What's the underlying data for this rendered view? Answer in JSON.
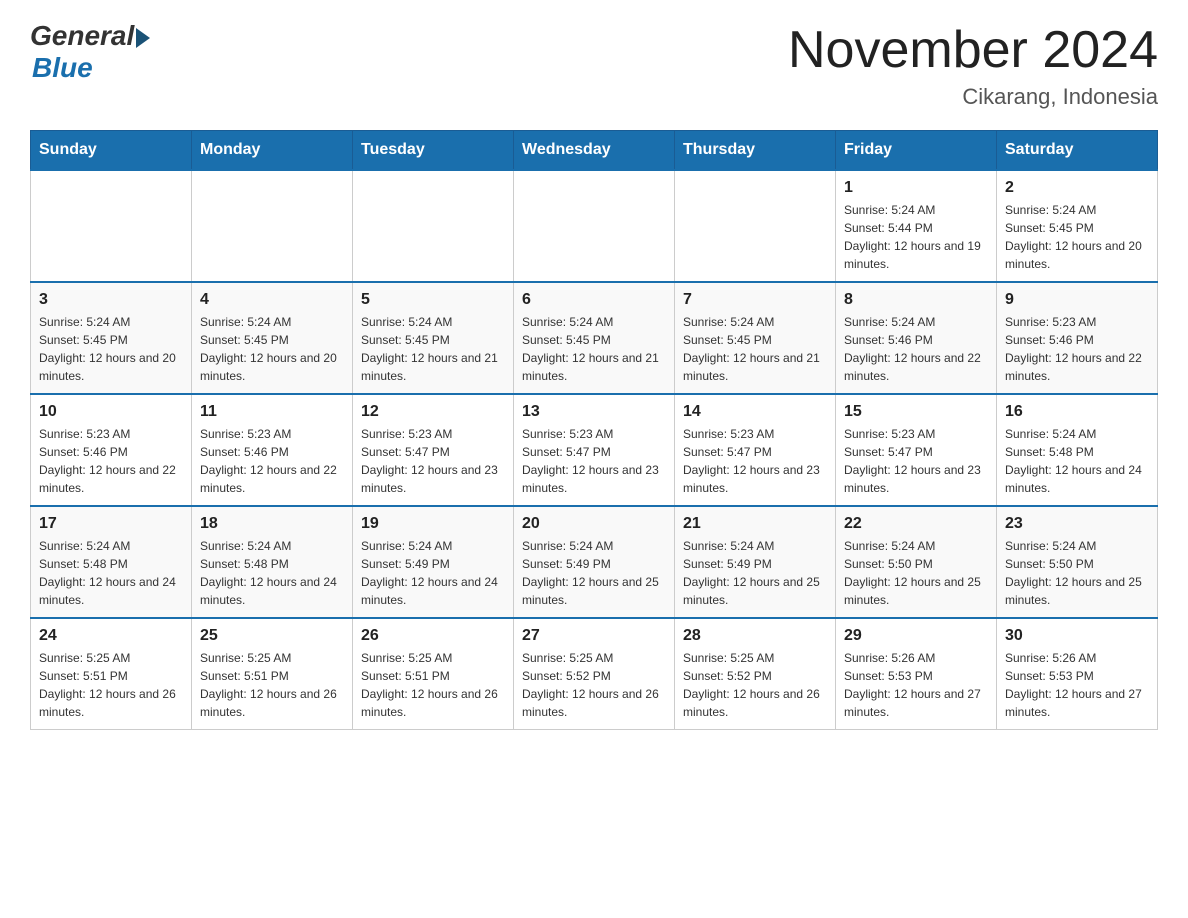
{
  "header": {
    "logo_general": "General",
    "logo_blue": "Blue",
    "title": "November 2024",
    "location": "Cikarang, Indonesia"
  },
  "days_of_week": [
    "Sunday",
    "Monday",
    "Tuesday",
    "Wednesday",
    "Thursday",
    "Friday",
    "Saturday"
  ],
  "weeks": [
    [
      {
        "day": "",
        "sunrise": "",
        "sunset": "",
        "daylight": ""
      },
      {
        "day": "",
        "sunrise": "",
        "sunset": "",
        "daylight": ""
      },
      {
        "day": "",
        "sunrise": "",
        "sunset": "",
        "daylight": ""
      },
      {
        "day": "",
        "sunrise": "",
        "sunset": "",
        "daylight": ""
      },
      {
        "day": "",
        "sunrise": "",
        "sunset": "",
        "daylight": ""
      },
      {
        "day": "1",
        "sunrise": "Sunrise: 5:24 AM",
        "sunset": "Sunset: 5:44 PM",
        "daylight": "Daylight: 12 hours and 19 minutes."
      },
      {
        "day": "2",
        "sunrise": "Sunrise: 5:24 AM",
        "sunset": "Sunset: 5:45 PM",
        "daylight": "Daylight: 12 hours and 20 minutes."
      }
    ],
    [
      {
        "day": "3",
        "sunrise": "Sunrise: 5:24 AM",
        "sunset": "Sunset: 5:45 PM",
        "daylight": "Daylight: 12 hours and 20 minutes."
      },
      {
        "day": "4",
        "sunrise": "Sunrise: 5:24 AM",
        "sunset": "Sunset: 5:45 PM",
        "daylight": "Daylight: 12 hours and 20 minutes."
      },
      {
        "day": "5",
        "sunrise": "Sunrise: 5:24 AM",
        "sunset": "Sunset: 5:45 PM",
        "daylight": "Daylight: 12 hours and 21 minutes."
      },
      {
        "day": "6",
        "sunrise": "Sunrise: 5:24 AM",
        "sunset": "Sunset: 5:45 PM",
        "daylight": "Daylight: 12 hours and 21 minutes."
      },
      {
        "day": "7",
        "sunrise": "Sunrise: 5:24 AM",
        "sunset": "Sunset: 5:45 PM",
        "daylight": "Daylight: 12 hours and 21 minutes."
      },
      {
        "day": "8",
        "sunrise": "Sunrise: 5:24 AM",
        "sunset": "Sunset: 5:46 PM",
        "daylight": "Daylight: 12 hours and 22 minutes."
      },
      {
        "day": "9",
        "sunrise": "Sunrise: 5:23 AM",
        "sunset": "Sunset: 5:46 PM",
        "daylight": "Daylight: 12 hours and 22 minutes."
      }
    ],
    [
      {
        "day": "10",
        "sunrise": "Sunrise: 5:23 AM",
        "sunset": "Sunset: 5:46 PM",
        "daylight": "Daylight: 12 hours and 22 minutes."
      },
      {
        "day": "11",
        "sunrise": "Sunrise: 5:23 AM",
        "sunset": "Sunset: 5:46 PM",
        "daylight": "Daylight: 12 hours and 22 minutes."
      },
      {
        "day": "12",
        "sunrise": "Sunrise: 5:23 AM",
        "sunset": "Sunset: 5:47 PM",
        "daylight": "Daylight: 12 hours and 23 minutes."
      },
      {
        "day": "13",
        "sunrise": "Sunrise: 5:23 AM",
        "sunset": "Sunset: 5:47 PM",
        "daylight": "Daylight: 12 hours and 23 minutes."
      },
      {
        "day": "14",
        "sunrise": "Sunrise: 5:23 AM",
        "sunset": "Sunset: 5:47 PM",
        "daylight": "Daylight: 12 hours and 23 minutes."
      },
      {
        "day": "15",
        "sunrise": "Sunrise: 5:23 AM",
        "sunset": "Sunset: 5:47 PM",
        "daylight": "Daylight: 12 hours and 23 minutes."
      },
      {
        "day": "16",
        "sunrise": "Sunrise: 5:24 AM",
        "sunset": "Sunset: 5:48 PM",
        "daylight": "Daylight: 12 hours and 24 minutes."
      }
    ],
    [
      {
        "day": "17",
        "sunrise": "Sunrise: 5:24 AM",
        "sunset": "Sunset: 5:48 PM",
        "daylight": "Daylight: 12 hours and 24 minutes."
      },
      {
        "day": "18",
        "sunrise": "Sunrise: 5:24 AM",
        "sunset": "Sunset: 5:48 PM",
        "daylight": "Daylight: 12 hours and 24 minutes."
      },
      {
        "day": "19",
        "sunrise": "Sunrise: 5:24 AM",
        "sunset": "Sunset: 5:49 PM",
        "daylight": "Daylight: 12 hours and 24 minutes."
      },
      {
        "day": "20",
        "sunrise": "Sunrise: 5:24 AM",
        "sunset": "Sunset: 5:49 PM",
        "daylight": "Daylight: 12 hours and 25 minutes."
      },
      {
        "day": "21",
        "sunrise": "Sunrise: 5:24 AM",
        "sunset": "Sunset: 5:49 PM",
        "daylight": "Daylight: 12 hours and 25 minutes."
      },
      {
        "day": "22",
        "sunrise": "Sunrise: 5:24 AM",
        "sunset": "Sunset: 5:50 PM",
        "daylight": "Daylight: 12 hours and 25 minutes."
      },
      {
        "day": "23",
        "sunrise": "Sunrise: 5:24 AM",
        "sunset": "Sunset: 5:50 PM",
        "daylight": "Daylight: 12 hours and 25 minutes."
      }
    ],
    [
      {
        "day": "24",
        "sunrise": "Sunrise: 5:25 AM",
        "sunset": "Sunset: 5:51 PM",
        "daylight": "Daylight: 12 hours and 26 minutes."
      },
      {
        "day": "25",
        "sunrise": "Sunrise: 5:25 AM",
        "sunset": "Sunset: 5:51 PM",
        "daylight": "Daylight: 12 hours and 26 minutes."
      },
      {
        "day": "26",
        "sunrise": "Sunrise: 5:25 AM",
        "sunset": "Sunset: 5:51 PM",
        "daylight": "Daylight: 12 hours and 26 minutes."
      },
      {
        "day": "27",
        "sunrise": "Sunrise: 5:25 AM",
        "sunset": "Sunset: 5:52 PM",
        "daylight": "Daylight: 12 hours and 26 minutes."
      },
      {
        "day": "28",
        "sunrise": "Sunrise: 5:25 AM",
        "sunset": "Sunset: 5:52 PM",
        "daylight": "Daylight: 12 hours and 26 minutes."
      },
      {
        "day": "29",
        "sunrise": "Sunrise: 5:26 AM",
        "sunset": "Sunset: 5:53 PM",
        "daylight": "Daylight: 12 hours and 27 minutes."
      },
      {
        "day": "30",
        "sunrise": "Sunrise: 5:26 AM",
        "sunset": "Sunset: 5:53 PM",
        "daylight": "Daylight: 12 hours and 27 minutes."
      }
    ]
  ]
}
